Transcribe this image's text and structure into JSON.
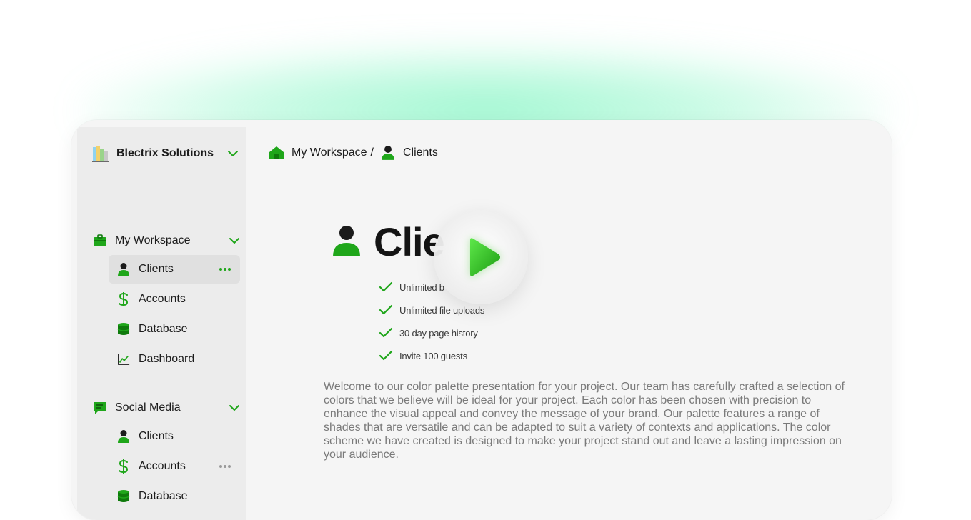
{
  "org": {
    "name": "Blectrix Solutions",
    "logo_icon": "building-books-icon"
  },
  "colors": {
    "accent": "#1fa61a",
    "accent_dark": "#0f7a0c",
    "glow": "#5ef0aa",
    "text": "#1c1c1c",
    "muted": "#7a7a7a"
  },
  "sidebar": {
    "sections": [
      {
        "label": "My Workspace",
        "icon": "briefcase-icon",
        "items": [
          {
            "label": "Clients",
            "icon": "person-icon",
            "active": true
          },
          {
            "label": "Accounts",
            "icon": "dollar-icon"
          },
          {
            "label": "Database",
            "icon": "database-icon"
          },
          {
            "label": "Dashboard",
            "icon": "chart-line-icon"
          }
        ]
      },
      {
        "label": "Social Media",
        "icon": "chat-bubble-icon",
        "items": [
          {
            "label": "Clients",
            "icon": "person-icon"
          },
          {
            "label": "Accounts",
            "icon": "dollar-icon"
          },
          {
            "label": "Database",
            "icon": "database-icon"
          }
        ]
      }
    ]
  },
  "breadcrumb": {
    "root": "My Workspace",
    "separator": "/",
    "current": "Clients"
  },
  "main": {
    "title": "Clie",
    "features": [
      "Unlimited b",
      "Unlimited file uploads",
      "30 day page history",
      "Invite 100 guests"
    ],
    "description": "Welcome to our color palette presentation for your project. Our team has carefully crafted a selection of colors that we believe will be ideal for your project. Each color has been chosen with precision to enhance the visual appeal and convey the message of your brand. Our palette features a range of shades that are versatile and can be adapted to suit a variety of contexts and applications. The color scheme we have created is designed to make your project stand out and leave a lasting impression on your audience."
  },
  "overlay": {
    "icon": "play-icon"
  }
}
